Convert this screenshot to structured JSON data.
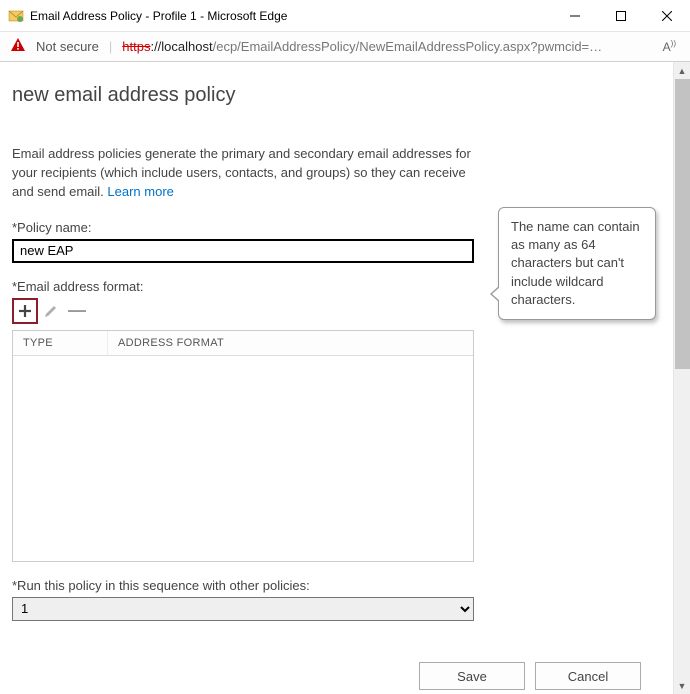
{
  "window": {
    "title": "Email Address Policy - Profile 1 - Microsoft Edge"
  },
  "addressbar": {
    "security_text": "Not secure",
    "url_https": "https",
    "url_host": "://localhost",
    "url_path": "/ecp/EmailAddressPolicy/NewEmailAddressPolicy.aspx?pwmcid=…"
  },
  "page": {
    "title": "new email address policy",
    "intro": "Email address policies generate the primary and secondary email addresses for your recipients (which include users, contacts, and groups) so they can receive and send email. ",
    "learn_more": "Learn more"
  },
  "policy_name": {
    "label": "*Policy name:",
    "value": "new EAP"
  },
  "format_section": {
    "label": "*Email address format:",
    "col_type": "TYPE",
    "col_format": "ADDRESS FORMAT"
  },
  "sequence": {
    "label": "*Run this policy in this sequence with other policies:",
    "value": "1"
  },
  "tooltip": {
    "text": "The name can contain as many as 64 characters but can't include wildcard characters."
  },
  "buttons": {
    "save": "Save",
    "cancel": "Cancel"
  }
}
